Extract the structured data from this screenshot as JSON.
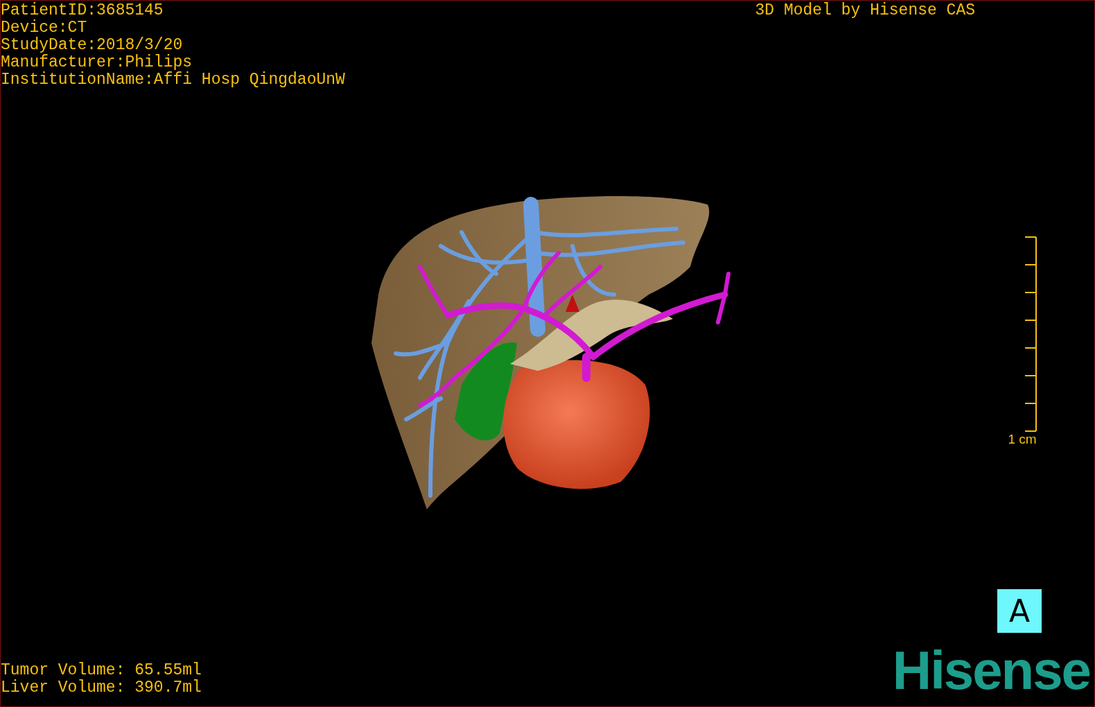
{
  "patient_info": [
    "PatientID:3685145",
    "Device:CT",
    "StudyDate:2018/3/20",
    "Manufacturer:Philips",
    "InstitutionName:Affi Hosp QingdaoUnW"
  ],
  "credit": "3D Model by Hisense CAS",
  "scale_bar": {
    "label": "1 cm"
  },
  "volumes": [
    "Tumor Volume: 65.55ml",
    "Liver Volume: 390.7ml"
  ],
  "orientation_label": "A",
  "logo": "Hisense"
}
